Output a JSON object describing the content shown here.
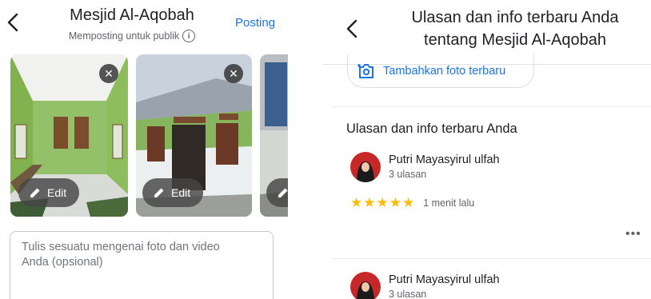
{
  "left": {
    "title": "Mesjid Al-Aqobah",
    "subtitle": "Memposting untuk publik",
    "post_label": "Posting",
    "edit_label": "Edit",
    "textbox_placeholder_line1": "Tulis sesuatu mengenai foto dan video",
    "textbox_placeholder_line2": "Anda (opsional)"
  },
  "right": {
    "title_line1": "Ulasan dan info terbaru Anda",
    "title_line2": "tentang Mesjid Al-Aqobah",
    "add_photo_label": "Tambahkan foto terbaru",
    "section_title": "Ulasan dan info terbaru Anda",
    "reviews": [
      {
        "name": "Putri Mayasyirul ulfah",
        "count": "3 ulasan",
        "rating": 5,
        "time": "1 menit lalu"
      },
      {
        "name": "Putri Mayasyirul ulfah",
        "count": "3 ulasan"
      }
    ]
  },
  "colors": {
    "accent": "#1a73e8",
    "star": "#fbbc04",
    "avatar_bg": "#c62828"
  }
}
